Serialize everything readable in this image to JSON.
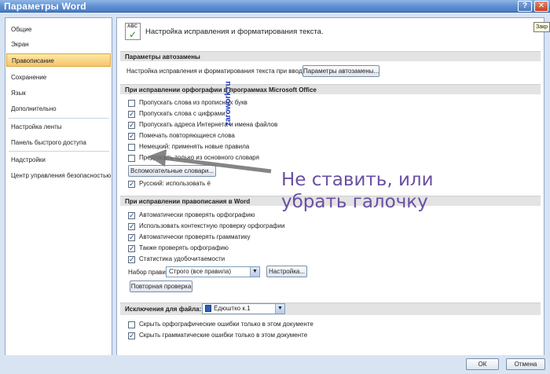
{
  "window": {
    "title": "Параметры Word"
  },
  "titlebar": {
    "help_glyph": "?",
    "close_glyph": "✕"
  },
  "tooltip": {
    "text": "Закр"
  },
  "sidebar": {
    "items": [
      {
        "label": "Общие"
      },
      {
        "label": "Экран"
      },
      {
        "label": "Правописание",
        "active": true
      },
      {
        "label": "Сохранение"
      },
      {
        "label": "Язык"
      },
      {
        "label": "Дополнительно"
      },
      {
        "label": "Настройка ленты"
      },
      {
        "label": "Панель быстрого доступа"
      },
      {
        "label": "Надстройки"
      },
      {
        "label": "Центр управления безопасностью"
      }
    ]
  },
  "header": {
    "text": "Настройка исправления и форматирования текста.",
    "icon_text": "ABC"
  },
  "autocorrect": {
    "section_title": "Параметры автозамены",
    "desc": "Настройка исправления и форматирования текста при вводе:",
    "button": "Параметры автозамены..."
  },
  "office": {
    "section_title": "При исправлении орфографии в программах Microsoft Office",
    "options": [
      {
        "label": "Пропускать слова из прописных букв",
        "checked": false
      },
      {
        "label": "Пропускать слова с цифрами",
        "checked": true
      },
      {
        "label": "Пропускать адреса Интернета и имена файлов",
        "checked": true
      },
      {
        "label": "Помечать повторяющиеся слова",
        "checked": true
      },
      {
        "label": "Немецкий: применять новые правила",
        "checked": false
      },
      {
        "label": "Предлагать только из основного словаря",
        "checked": false
      }
    ],
    "dict_button": "Вспомогательные словари...",
    "russian_option": {
      "label": "Русский: использовать ё",
      "checked": true
    }
  },
  "word": {
    "section_title": "При исправлении правописания в Word",
    "options": [
      {
        "label": "Автоматически проверять орфографию",
        "checked": true
      },
      {
        "label": "Использовать контекстную проверку орфографии",
        "checked": true
      },
      {
        "label": "Автоматически проверять грамматику",
        "checked": true
      },
      {
        "label": "Также проверять орфографию",
        "checked": true
      },
      {
        "label": "Статистика удобочитаемости",
        "checked": true
      }
    ],
    "ruleset_label": "Набор правил:",
    "ruleset_value": "Строго (все правила)",
    "settings_button": "Настройка...",
    "recheck_button": "Повторная проверка"
  },
  "exceptions": {
    "section_label": "Исключения для файла:",
    "file_value": "Ёдюштко к.1",
    "options": [
      {
        "label": "Скрыть орфографические ошибки только в этом документе",
        "checked": false
      },
      {
        "label": "Скрыть грамматические ошибки только в этом документе",
        "checked": true
      }
    ]
  },
  "footer": {
    "ok": "ОК",
    "cancel": "Отмена"
  },
  "overlay": {
    "watermark": "zarowork.ru",
    "annotation_line1": "Не ставить, или",
    "annotation_line2": "убрать галочку"
  }
}
